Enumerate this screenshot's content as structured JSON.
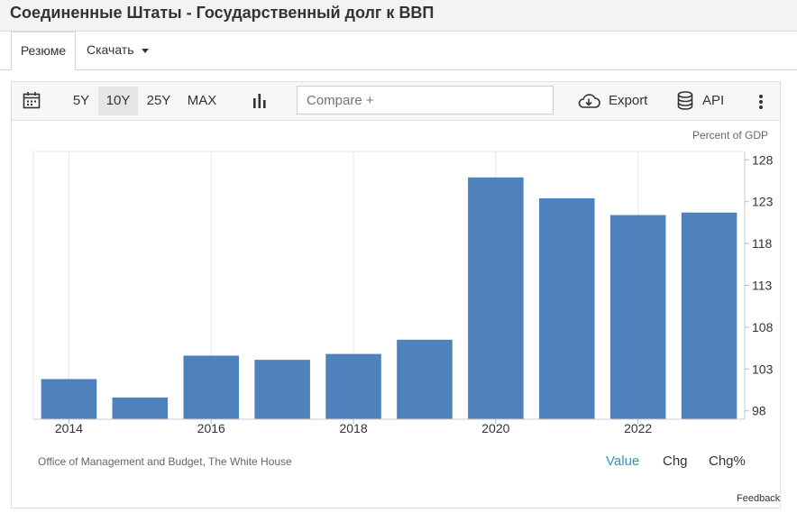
{
  "page": {
    "title": "Соединенные Штаты - Государственный долг к ВВП"
  },
  "tabs": {
    "summary": "Резюме",
    "download": "Скачать"
  },
  "toolbar": {
    "ranges": [
      "5Y",
      "10Y",
      "25Y",
      "MAX"
    ],
    "selected_range": "10Y",
    "compare_placeholder": "Compare +",
    "export_label": "Export",
    "api_label": "API"
  },
  "chart_data": {
    "type": "bar",
    "unit_label": "Percent of GDP",
    "x": [
      2014,
      2015,
      2016,
      2017,
      2018,
      2019,
      2020,
      2021,
      2022,
      2023
    ],
    "xticks": [
      "2014",
      "2016",
      "2018",
      "2020",
      "2022"
    ],
    "values": [
      101.8,
      99.6,
      104.6,
      104.1,
      104.8,
      106.5,
      125.9,
      123.4,
      121.4,
      121.7
    ],
    "yticks": [
      98,
      103,
      108,
      113,
      118,
      123,
      128
    ],
    "ylim": [
      97,
      129
    ],
    "grid": "vertical",
    "color": "#4f81bd"
  },
  "footer": {
    "source": "Office of Management and Budget, The White House",
    "views": [
      "Value",
      "Chg",
      "Chg%"
    ],
    "active_view": "Value",
    "feedback": "Feedback"
  }
}
